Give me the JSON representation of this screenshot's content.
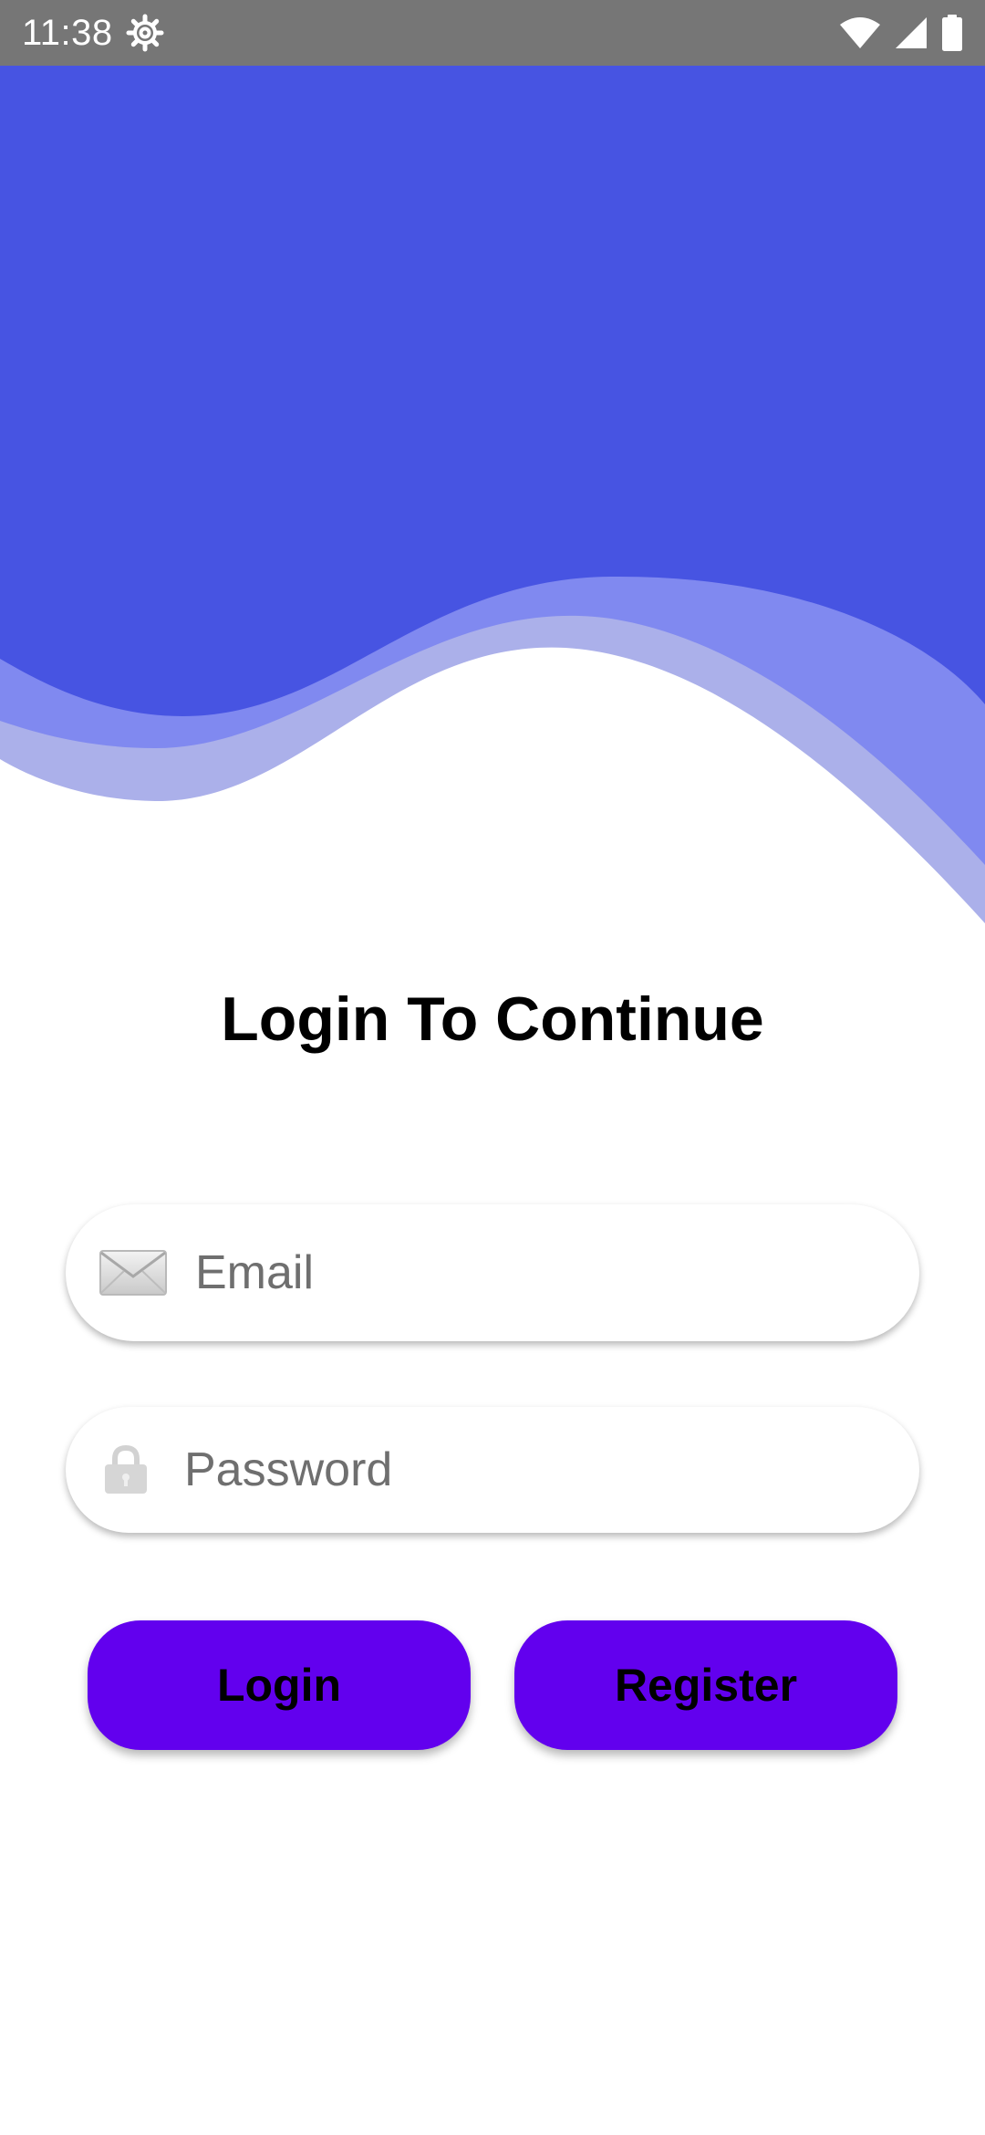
{
  "status_bar": {
    "time": "11:38",
    "icons": [
      "settings-gear-icon",
      "wifi-icon",
      "signal-icon",
      "battery-icon"
    ],
    "background": "#767676"
  },
  "header": {
    "colors": {
      "primary": "#4754e2",
      "middle": "#8089f0",
      "light": "#abb0ea"
    }
  },
  "login": {
    "title": "Login To Continue",
    "email": {
      "placeholder": "Email",
      "value": "",
      "icon": "envelope-icon"
    },
    "password": {
      "placeholder": "Password",
      "value": "",
      "icon": "padlock-icon"
    },
    "buttons": {
      "login_label": "Login",
      "register_label": "Register",
      "color": "#6200ee"
    }
  }
}
